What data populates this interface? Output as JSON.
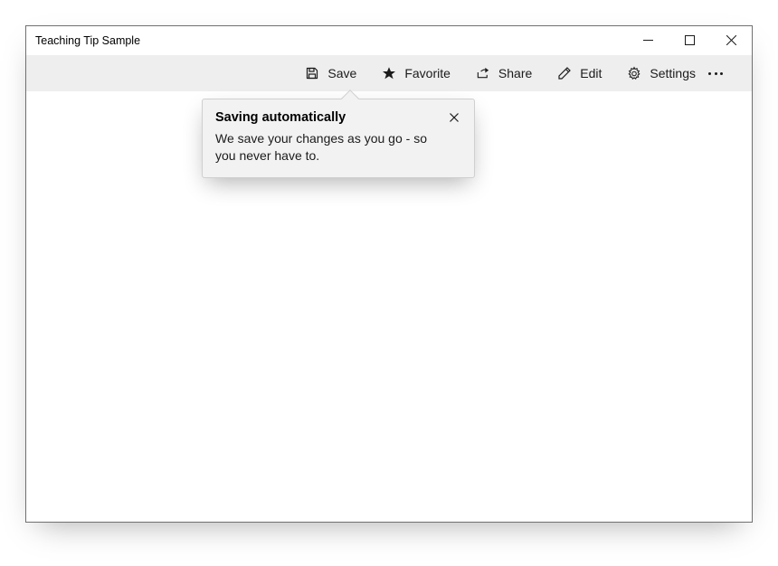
{
  "window": {
    "title": "Teaching Tip Sample"
  },
  "commandbar": {
    "save_label": "Save",
    "favorite_label": "Favorite",
    "share_label": "Share",
    "edit_label": "Edit",
    "settings_label": "Settings"
  },
  "teaching_tip": {
    "title": "Saving automatically",
    "body": "We save your changes as you go - so you never have to."
  }
}
